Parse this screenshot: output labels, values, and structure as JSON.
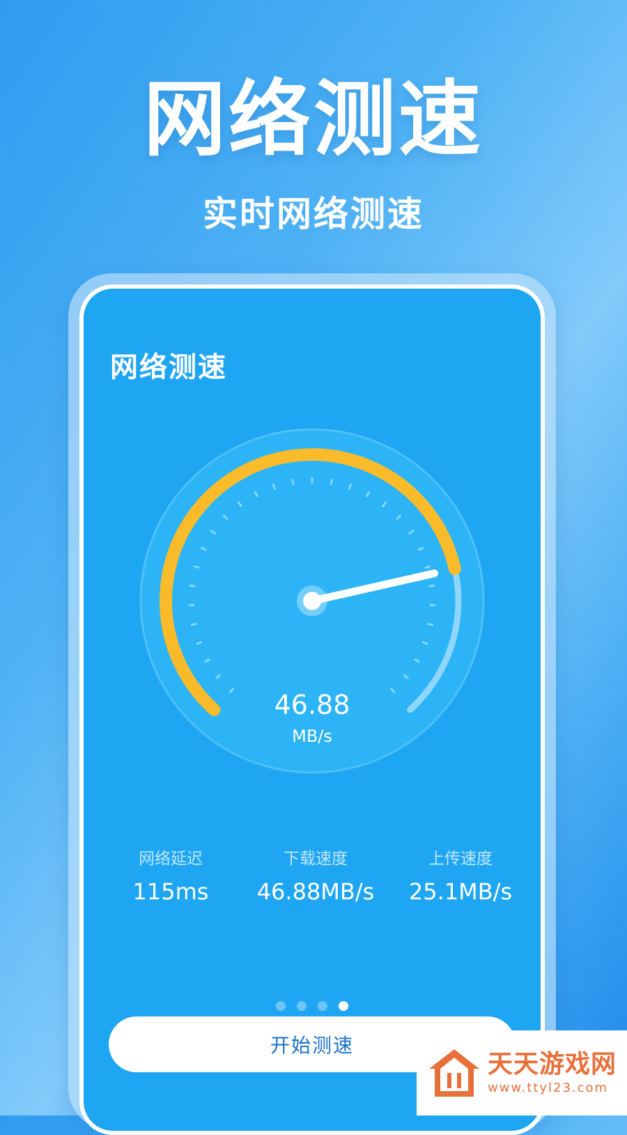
{
  "hero": {
    "title": "网络测速",
    "subtitle": "实时网络测速"
  },
  "app": {
    "title": "网络测速"
  },
  "gauge": {
    "value": "46.88",
    "unit": "MB/s",
    "fill_fraction": 0.78,
    "arc_color": "#f9bb2a",
    "track_color": "#8fd6fb"
  },
  "stats": [
    {
      "label": "网络延迟",
      "value": "115ms"
    },
    {
      "label": "下载速度",
      "value": "46.88MB/s"
    },
    {
      "label": "上传速度",
      "value": "25.1MB/s"
    }
  ],
  "pager": {
    "count": 4,
    "active": 3
  },
  "start_button": {
    "label": "开始测速"
  },
  "watermark": {
    "brand": "天天游戏网",
    "url": "www.ttyl23.com"
  },
  "colors": {
    "screen_bg": "#1ea6f2",
    "accent": "#f9bb2a",
    "button_text": "#1a72c8",
    "watermark": "#e8703a"
  }
}
